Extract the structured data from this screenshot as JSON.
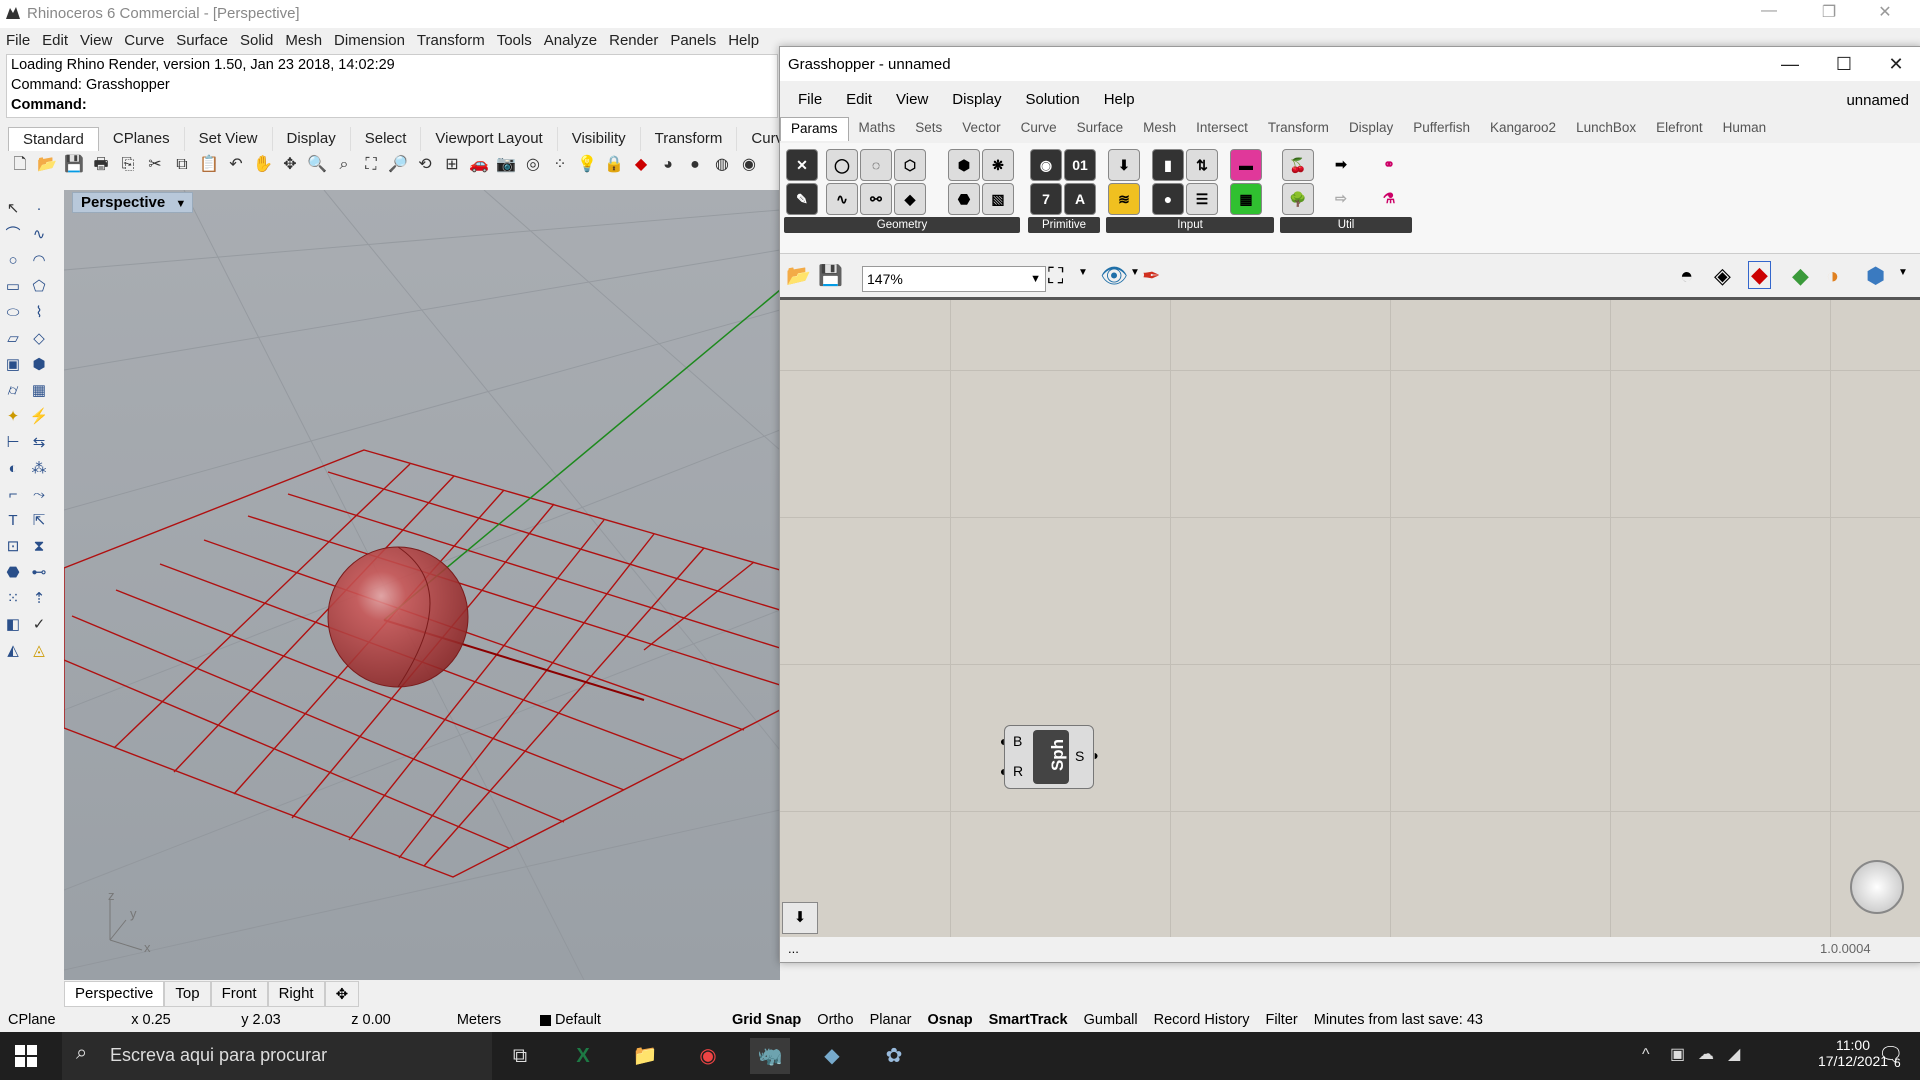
{
  "rhino": {
    "title": "Rhinoceros 6 Commercial - [Perspective]",
    "menu": [
      "File",
      "Edit",
      "View",
      "Curve",
      "Surface",
      "Solid",
      "Mesh",
      "Dimension",
      "Transform",
      "Tools",
      "Analyze",
      "Render",
      "Panels",
      "Help"
    ],
    "history": [
      "Loading Rhino Render, version 1.50, Jan 23 2018, 14:02:29",
      "Command: Grasshopper"
    ],
    "command_label": "Command:",
    "toolbar_tabs": [
      "Standard",
      "CPlanes",
      "Set View",
      "Display",
      "Select",
      "Viewport Layout",
      "Visibility",
      "Transform",
      "Curv"
    ],
    "viewport_label": "Perspective",
    "view_tabs": [
      "Perspective",
      "Top",
      "Front",
      "Right"
    ],
    "axes_labels": {
      "z": "z",
      "y": "y",
      "x": "x"
    }
  },
  "status": {
    "cplane": "CPlane",
    "x": "x 0.25",
    "y": "y 2.03",
    "z": "z 0.00",
    "units": "Meters",
    "layer": "Default",
    "grid_snap": "Grid Snap",
    "ortho": "Ortho",
    "planar": "Planar",
    "osnap": "Osnap",
    "smarttrack": "SmartTrack",
    "gumball": "Gumball",
    "record_history": "Record History",
    "filter": "Filter",
    "minutes": "Minutes from last save: 43"
  },
  "grasshopper": {
    "title": "Grasshopper - unnamed",
    "menu": [
      "File",
      "Edit",
      "View",
      "Display",
      "Solution",
      "Help"
    ],
    "doc_name": "unnamed",
    "tabs": [
      "Params",
      "Maths",
      "Sets",
      "Vector",
      "Curve",
      "Surface",
      "Mesh",
      "Intersect",
      "Transform",
      "Display",
      "Pufferfish",
      "Kangaroo2",
      "LunchBox",
      "Elefront",
      "Human"
    ],
    "groups": [
      "Geometry",
      "Primitive",
      "Input",
      "Util"
    ],
    "zoom": "147%",
    "component": {
      "nickname": "Sph",
      "inputs": [
        "B",
        "R"
      ],
      "output": "S"
    },
    "status_left": "...",
    "version": "1.0.0004"
  },
  "taskbar": {
    "search_placeholder": "Escreva aqui para procurar",
    "time": "11:00",
    "date": "17/12/2021",
    "notif_count": "6"
  }
}
